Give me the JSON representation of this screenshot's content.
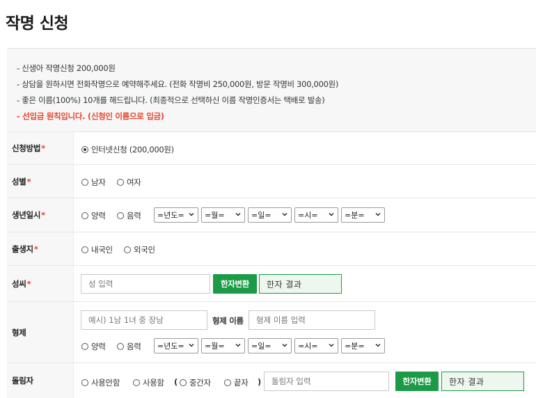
{
  "page": {
    "title": "작명 신청"
  },
  "notice": {
    "lines": [
      "- 신생아 작명신청 200,000원",
      "- 상담을 원하시면 전화작명으로 예약해주세요. (전화 작명비 250,000원, 방문 작명비 300,000원)",
      "- 좋은 이름(100%) 10개를 해드립니다. (최종적으로 선택하신 이름 작명인증서는 택배로 발송)",
      "- 선입금 원칙입니다. (신청인 이름으로 입금)"
    ]
  },
  "form": {
    "required_mark": "*",
    "method": {
      "label": "신청방법",
      "option": "인터넷신청 (200,000원)"
    },
    "gender": {
      "label": "성별",
      "male": "남자",
      "female": "여자"
    },
    "birth": {
      "label": "생년일시",
      "solar": "양력",
      "lunar": "음력",
      "year": "=년도=",
      "month": "=월=",
      "day": "=일=",
      "hour": "=시=",
      "minute": "=분="
    },
    "birthplace": {
      "label": "출생지",
      "domestic": "내국인",
      "foreign": "외국인"
    },
    "surname": {
      "label": "성씨",
      "placeholder": "성 입력",
      "convert_button": "한자변환",
      "result": "한자 결과"
    },
    "siblings": {
      "label": "형제",
      "order_placeholder": "예시) 1남 1녀 중 장남",
      "name_label": "형제 이름",
      "name_placeholder": "형제 이름 입력",
      "solar": "양력",
      "lunar": "음력",
      "year": "=년도=",
      "month": "=월=",
      "day": "=일=",
      "hour": "=시=",
      "minute": "=분="
    },
    "generation": {
      "label": "돌림자",
      "not_used": "사용안함",
      "used": "사용함",
      "open_paren": "(",
      "middle": "중간자",
      "last": "끝자",
      "close_paren": ")",
      "placeholder": "돌림자 입력",
      "convert_button": "한자변환",
      "result": "한자 결과"
    }
  }
}
